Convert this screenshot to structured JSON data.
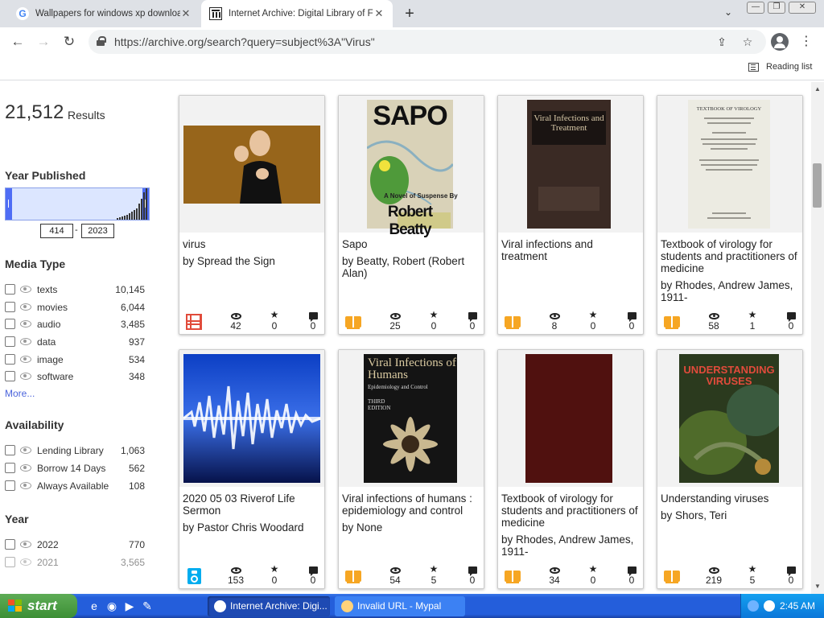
{
  "browser": {
    "tabs": [
      {
        "title": "Wallpapers for windows xp downloa"
      },
      {
        "title": "Internet Archive: Digital Library of F"
      }
    ],
    "url": "https://archive.org/search?query=subject%3A\"Virus\"",
    "reading_list": "Reading list"
  },
  "sidebar": {
    "count": "21,512",
    "count_label": "Results",
    "year_published": {
      "heading": "Year Published",
      "min": "414",
      "max": "2023",
      "dash": "-"
    },
    "media_type": {
      "heading": "Media Type",
      "items": [
        {
          "label": "texts",
          "count": "10,145"
        },
        {
          "label": "movies",
          "count": "6,044"
        },
        {
          "label": "audio",
          "count": "3,485"
        },
        {
          "label": "data",
          "count": "937"
        },
        {
          "label": "image",
          "count": "534"
        },
        {
          "label": "software",
          "count": "348"
        }
      ],
      "more": "More..."
    },
    "availability": {
      "heading": "Availability",
      "items": [
        {
          "label": "Lending Library",
          "count": "1,063"
        },
        {
          "label": "Borrow 14 Days",
          "count": "562"
        },
        {
          "label": "Always Available",
          "count": "108"
        }
      ]
    },
    "year": {
      "heading": "Year",
      "items": [
        {
          "label": "2022",
          "count": "770"
        },
        {
          "label": "2021",
          "count": "3,565"
        }
      ]
    }
  },
  "results": [
    {
      "title": "virus",
      "author": "by Spread the Sign",
      "media": "movies",
      "views": "42",
      "favorites": "0",
      "reviews": "0"
    },
    {
      "title": "Sapo",
      "author": "by Beatty, Robert (Robert Alan)",
      "media": "texts",
      "views": "25",
      "favorites": "0",
      "reviews": "0",
      "cover_text": "SAPO",
      "cover_sub": "A Novel of Suspense By",
      "cover_author": "Robert Beatty"
    },
    {
      "title": "Viral infections and treatment",
      "author": "",
      "media": "texts",
      "views": "8",
      "favorites": "0",
      "reviews": "0",
      "cover_text": "Viral Infections and Treatment"
    },
    {
      "title": "Textbook of virology for students and practitioners of medicine",
      "author": "by Rhodes, Andrew James, 1911-",
      "media": "texts",
      "views": "58",
      "favorites": "1",
      "reviews": "0",
      "cover_text": "TEXTBOOK OF VIROLOGY"
    },
    {
      "title": "2020 05 03 Riverof Life Sermon",
      "author": "by Pastor Chris Woodard",
      "media": "audio",
      "views": "153",
      "favorites": "0",
      "reviews": "0"
    },
    {
      "title": "Viral infections of humans : epidemiology and control",
      "author": "by None",
      "media": "texts",
      "views": "54",
      "favorites": "5",
      "reviews": "0",
      "cover_text": "Viral Infections of Humans",
      "cover_sub": "Epidemiology and Control",
      "cover_edition": "THIRD EDITION"
    },
    {
      "title": "Textbook of virology for students and practitioners of medicine",
      "author": "by Rhodes, Andrew James, 1911-",
      "media": "texts",
      "views": "34",
      "favorites": "0",
      "reviews": "0"
    },
    {
      "title": "Understanding viruses",
      "author": "by Shors, Teri",
      "media": "texts",
      "views": "219",
      "favorites": "5",
      "reviews": "0",
      "cover_text": "UNDERSTANDING VIRUSES"
    }
  ],
  "taskbar": {
    "start": "start",
    "tasks": [
      {
        "label": "Internet Archive: Digi..."
      },
      {
        "label": "Invalid URL - Mypal"
      }
    ],
    "clock": "2:45 AM"
  },
  "colors": {
    "accent": "#4b64dc",
    "texts_icon": "#f6a623",
    "movies_icon": "#e14b3b",
    "audio_icon": "#00adef"
  }
}
